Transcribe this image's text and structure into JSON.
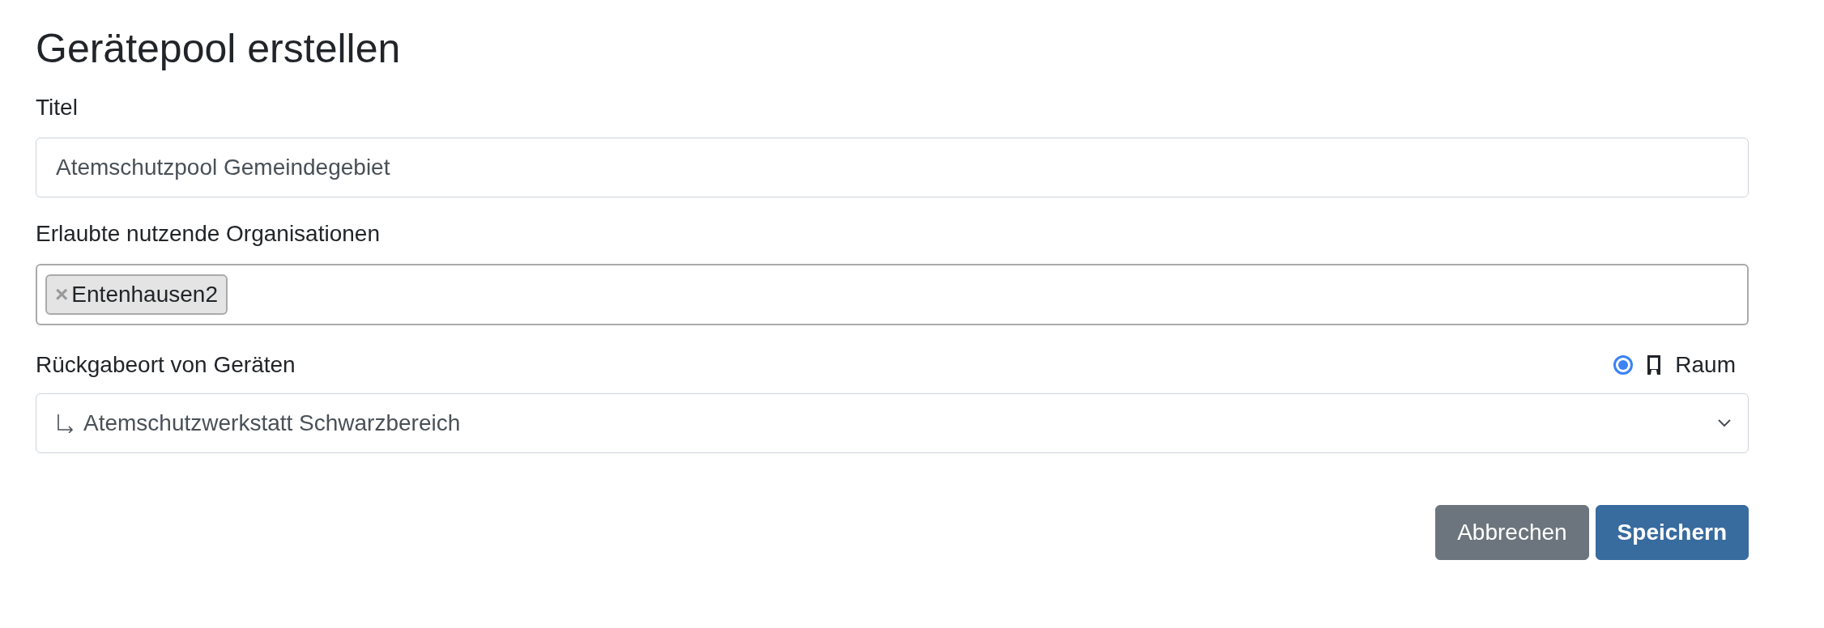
{
  "heading": "Gerätepool erstellen",
  "title_field": {
    "label": "Titel",
    "value": "Atemschutzpool Gemeindegebiet"
  },
  "organisations_field": {
    "label": "Erlaubte nutzende Organisationen",
    "tags": [
      {
        "remove": "×",
        "label": "Entenhausen2"
      }
    ]
  },
  "return_location": {
    "label": "Rückgabeort von Geräten",
    "options": [
      {
        "label": "Raum",
        "selected": true
      }
    ],
    "value": "Atemschutzwerkstatt Schwarzbereich"
  },
  "buttons": [
    {
      "label": "Abbrechen",
      "kind": "secondary"
    },
    {
      "label": "Speichern",
      "kind": "primary"
    }
  ]
}
